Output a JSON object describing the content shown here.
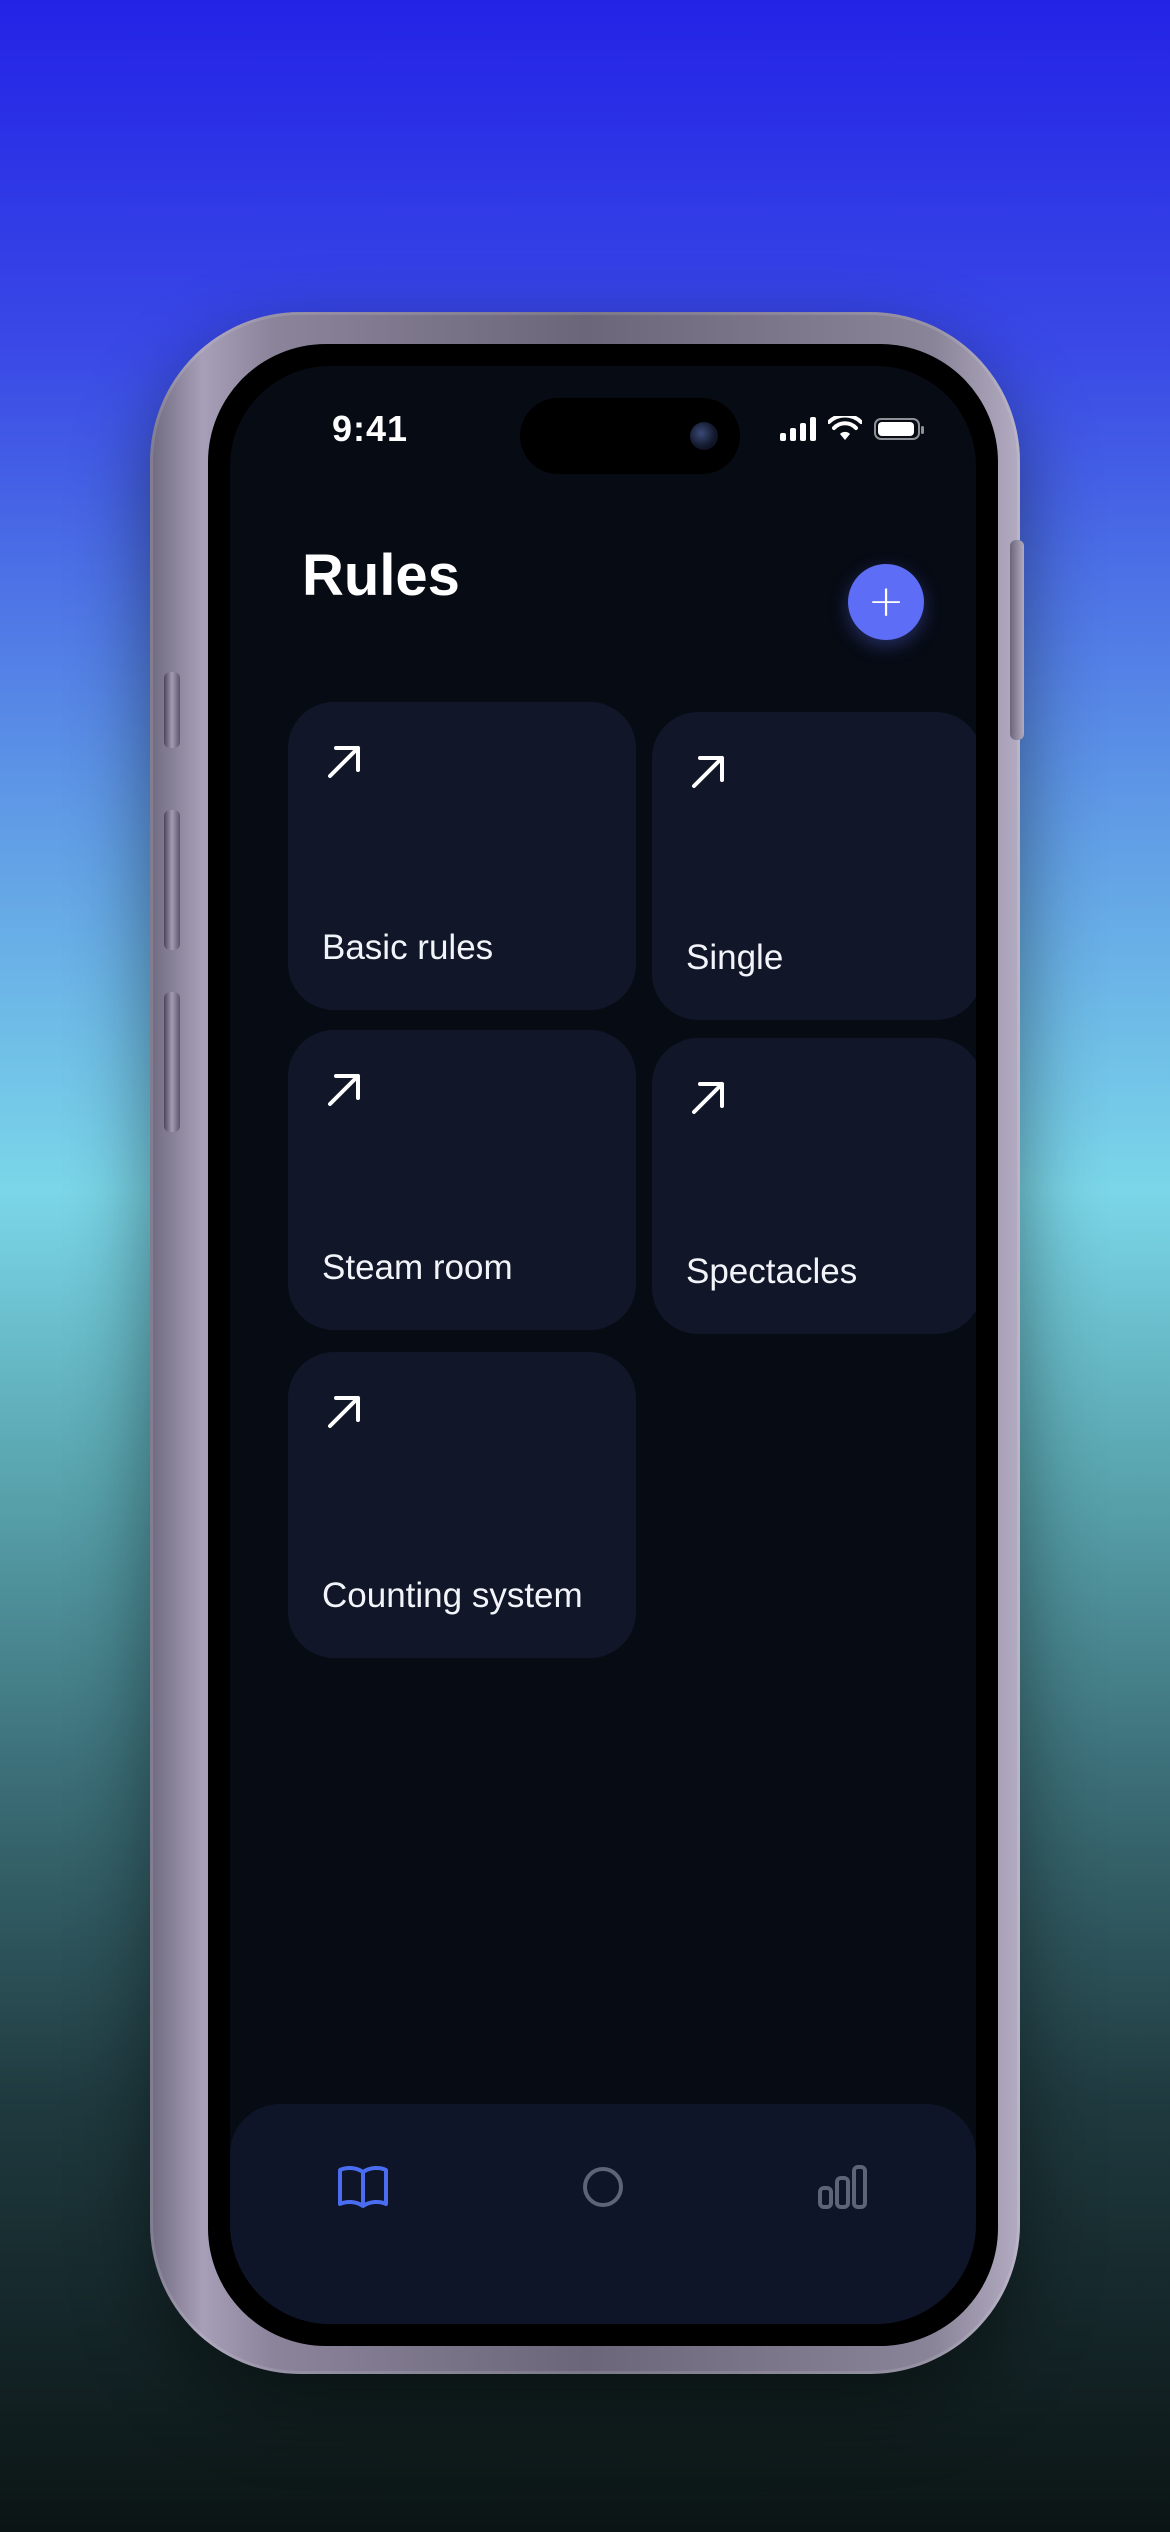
{
  "status_bar": {
    "time": "9:41"
  },
  "header": {
    "title": "Rules",
    "add_button_label": "+"
  },
  "cards": [
    {
      "label": "Basic rules",
      "icon": "arrow-up-right-icon"
    },
    {
      "label": "Single",
      "icon": "arrow-up-right-icon"
    },
    {
      "label": "Steam room",
      "icon": "arrow-up-right-icon"
    },
    {
      "label": "Spectacles",
      "icon": "arrow-up-right-icon"
    },
    {
      "label": "Counting system",
      "icon": "arrow-up-right-icon"
    }
  ],
  "tab_bar": {
    "items": [
      {
        "icon": "book-icon",
        "active": true
      },
      {
        "icon": "circle-icon",
        "active": false
      },
      {
        "icon": "bar-chart-icon",
        "active": false
      }
    ]
  },
  "colors": {
    "screen_background": "#070b14",
    "card_background": "#111729",
    "accent": "#5d6df5",
    "tab_active": "#4a6cf0",
    "tab_inactive": "#5c6478"
  }
}
